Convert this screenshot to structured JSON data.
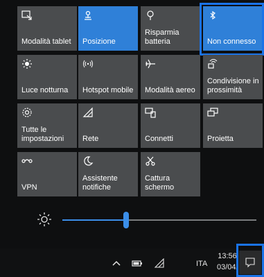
{
  "tiles": [
    {
      "label": "Modalità tablet",
      "icon": "tablet-mode-icon",
      "active": false
    },
    {
      "label": "Posizione",
      "icon": "location-icon",
      "active": true
    },
    {
      "label": "Risparmia\nbatteria",
      "icon": "battery-saver-icon",
      "active": false
    },
    {
      "label": "Non connesso",
      "icon": "bluetooth-icon",
      "active": true
    },
    {
      "label": "Luce notturna",
      "icon": "night-light-icon",
      "active": false
    },
    {
      "label": "Hotspot mobile",
      "icon": "mobile-hotspot-icon",
      "active": false
    },
    {
      "label": "Modalità aereo",
      "icon": "airplane-icon",
      "active": false
    },
    {
      "label": "Condivisione in\nprossimità",
      "icon": "nearby-share-icon",
      "active": false
    },
    {
      "label": "Tutte le\nimpostazioni",
      "icon": "settings-icon",
      "active": false
    },
    {
      "label": "Rete",
      "icon": "network-icon",
      "active": false
    },
    {
      "label": "Connetti",
      "icon": "connect-icon",
      "active": false
    },
    {
      "label": "Proietta",
      "icon": "project-icon",
      "active": false
    },
    {
      "label": "VPN",
      "icon": "vpn-icon",
      "active": false
    },
    {
      "label": "Assistente\nnotifiche",
      "icon": "focus-assist-icon",
      "active": false
    },
    {
      "label": "Cattura\nschermo",
      "icon": "screen-snip-icon",
      "active": false
    }
  ],
  "brightness": {
    "icon": "brightness-icon",
    "level": 0.33
  },
  "taskbar": {
    "language": "ITA",
    "time": "13:56",
    "date": "03/04/",
    "icons": [
      "chevron-up-icon",
      "battery-icon",
      "network-icon"
    ],
    "notification_icon": "action-center-icon"
  },
  "colors": {
    "accent": "#2f80d8",
    "tile": "#4a4c4e",
    "highlight": "#1a73e8"
  }
}
